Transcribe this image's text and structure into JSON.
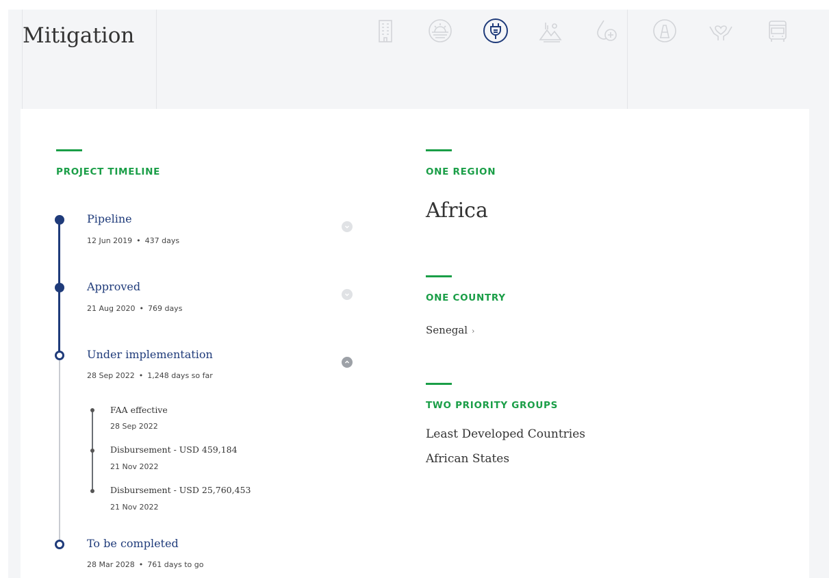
{
  "page": {
    "title": "Mitigation"
  },
  "sector_icons": [
    {
      "name": "building-icon",
      "active": false
    },
    {
      "name": "sun-horizon-icon",
      "active": false
    },
    {
      "name": "energy-plug-icon",
      "active": true
    },
    {
      "name": "landscape-icon",
      "active": false
    },
    {
      "name": "health-drop-icon",
      "active": false
    },
    {
      "name": "infrastructure-icon",
      "active": false
    },
    {
      "name": "hands-heart-icon",
      "active": false
    },
    {
      "name": "transport-bus-icon",
      "active": false
    }
  ],
  "timeline": {
    "label": "PROJECT TIMELINE",
    "stages": [
      {
        "name": "Pipeline",
        "date": "12 Jun 2019",
        "sep": "•",
        "duration": "437 days"
      },
      {
        "name": "Approved",
        "date": "21 Aug 2020",
        "sep": "•",
        "duration": "769 days"
      },
      {
        "name": "Under implementation",
        "date": "28 Sep 2022",
        "sep": "•",
        "duration": "1,248 days so far",
        "events": [
          {
            "name": "FAA effective",
            "date": "28 Sep 2022"
          },
          {
            "name": "Disbursement - USD 459,184",
            "date": "21 Nov 2022"
          },
          {
            "name": "Disbursement - USD 25,760,453",
            "date": "21 Nov 2022"
          }
        ]
      },
      {
        "name": "To be completed",
        "date": "28 Mar 2028",
        "sep": "•",
        "duration": "761 days to go"
      }
    ]
  },
  "region": {
    "label": "ONE REGION",
    "value": "Africa"
  },
  "country": {
    "label": "ONE COUNTRY",
    "value": "Senegal",
    "chevron": "›"
  },
  "priority_groups": {
    "label": "TWO PRIORITY GROUPS",
    "items": [
      "Least Developed Countries",
      "African States"
    ]
  },
  "colors": {
    "accent": "#1a9e47",
    "timeline_blue": "#1f3b7a",
    "icon_inactive": "#d2d4d8"
  }
}
